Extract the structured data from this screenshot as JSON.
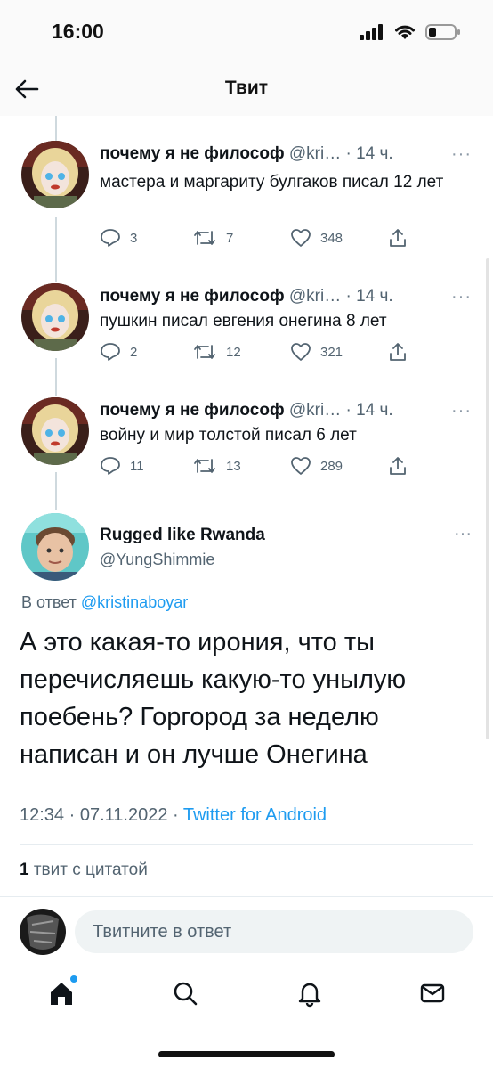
{
  "status_bar": {
    "time": "16:00"
  },
  "header": {
    "title": "Твит"
  },
  "thread": [
    {
      "name": "почему я не философ",
      "handle": "@kri…",
      "time": "· 14 ч.",
      "text": "мастера и маргариту булгаков писал 12 лет",
      "replies": "3",
      "retweets": "7",
      "likes": "348"
    },
    {
      "name": "почему я не философ",
      "handle": "@kri…",
      "time": "· 14 ч.",
      "text": "пушкин писал евгения онегина 8 лет",
      "replies": "2",
      "retweets": "12",
      "likes": "321"
    },
    {
      "name": "почему я не философ",
      "handle": "@kri…",
      "time": "· 14 ч.",
      "text": "войну и мир толстой писал 6 лет",
      "replies": "11",
      "retweets": "13",
      "likes": "289"
    }
  ],
  "main_tweet": {
    "name": "Rugged like Rwanda",
    "handle": "@YungShimmie",
    "reply_prefix": "В ответ",
    "reply_to": "@kristinaboyar",
    "text": "А это какая-то ирония, что ты перечисляешь какую-то унылую поебень? Горгород за неделю написан и он лучше Онегина",
    "date": "12:34 · 07.11.2022 ·",
    "source": "Twitter for Android",
    "quote_count": "1",
    "quote_label": "твит с цитатой"
  },
  "reply_bar": {
    "placeholder": "Твитните в ответ"
  },
  "icons": {
    "back": "arrow-left-icon",
    "reply": "comment-icon",
    "retweet": "retweet-icon",
    "like": "heart-icon",
    "share": "share-icon",
    "home": "home-icon",
    "search": "search-icon",
    "notifications": "bell-icon",
    "messages": "mail-icon"
  },
  "colors": {
    "accent": "#1d9bf0",
    "muted": "#536471",
    "text": "#0f1419"
  }
}
